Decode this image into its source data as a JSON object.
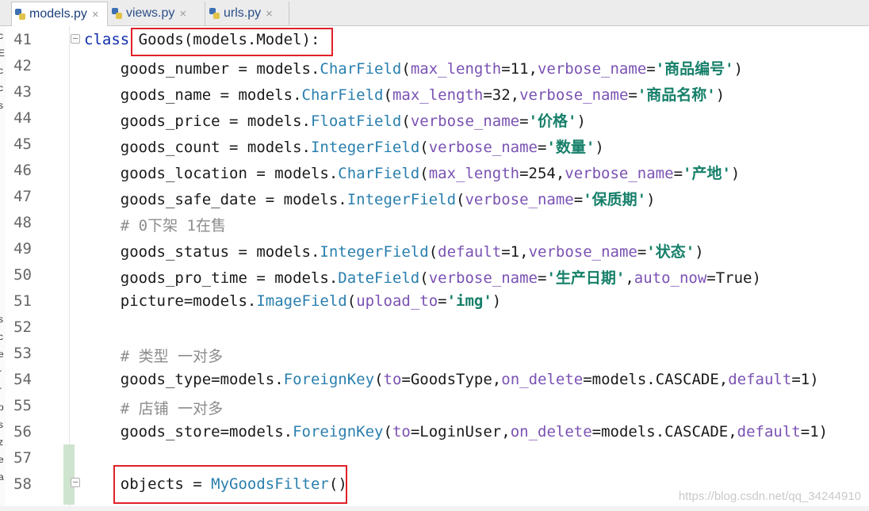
{
  "tabs": [
    {
      "label": "models.py",
      "active": true
    },
    {
      "label": "views.py",
      "active": false
    },
    {
      "label": "urls.py",
      "active": false
    }
  ],
  "close_glyph": "×",
  "left_panel_fragments": [
    "c",
    "E",
    "c",
    "c",
    "s",
    "s",
    "c",
    "e",
    "r",
    "r",
    "p",
    "s",
    "z",
    "e",
    "a"
  ],
  "lines": [
    {
      "num": "41",
      "tokens": [
        {
          "t": "class ",
          "c": "kw"
        },
        {
          "t": "Goods(models.Model):",
          "c": "plain"
        }
      ]
    },
    {
      "num": "42",
      "tokens": [
        {
          "t": "    goods_number = models.",
          "c": "plain"
        },
        {
          "t": "CharField",
          "c": "fn"
        },
        {
          "t": "(",
          "c": "plain"
        },
        {
          "t": "max_length",
          "c": "par"
        },
        {
          "t": "=11,",
          "c": "plain"
        },
        {
          "t": "verbose_name",
          "c": "par"
        },
        {
          "t": "=",
          "c": "plain"
        },
        {
          "t": "'商品编号'",
          "c": "str"
        },
        {
          "t": ")",
          "c": "plain"
        }
      ]
    },
    {
      "num": "43",
      "tokens": [
        {
          "t": "    goods_name = models.",
          "c": "plain"
        },
        {
          "t": "CharField",
          "c": "fn"
        },
        {
          "t": "(",
          "c": "plain"
        },
        {
          "t": "max_length",
          "c": "par"
        },
        {
          "t": "=32,",
          "c": "plain"
        },
        {
          "t": "verbose_name",
          "c": "par"
        },
        {
          "t": "=",
          "c": "plain"
        },
        {
          "t": "'商品名称'",
          "c": "str"
        },
        {
          "t": ")",
          "c": "plain"
        }
      ]
    },
    {
      "num": "44",
      "tokens": [
        {
          "t": "    goods_price = models.",
          "c": "plain"
        },
        {
          "t": "FloatField",
          "c": "fn"
        },
        {
          "t": "(",
          "c": "plain"
        },
        {
          "t": "verbose_name",
          "c": "par"
        },
        {
          "t": "=",
          "c": "plain"
        },
        {
          "t": "'价格'",
          "c": "str"
        },
        {
          "t": ")",
          "c": "plain"
        }
      ]
    },
    {
      "num": "45",
      "tokens": [
        {
          "t": "    goods_count = models.",
          "c": "plain"
        },
        {
          "t": "IntegerField",
          "c": "fn"
        },
        {
          "t": "(",
          "c": "plain"
        },
        {
          "t": "verbose_name",
          "c": "par"
        },
        {
          "t": "=",
          "c": "plain"
        },
        {
          "t": "'数量'",
          "c": "str"
        },
        {
          "t": ")",
          "c": "plain"
        }
      ]
    },
    {
      "num": "46",
      "tokens": [
        {
          "t": "    goods_location = models.",
          "c": "plain"
        },
        {
          "t": "CharField",
          "c": "fn"
        },
        {
          "t": "(",
          "c": "plain"
        },
        {
          "t": "max_length",
          "c": "par"
        },
        {
          "t": "=254,",
          "c": "plain"
        },
        {
          "t": "verbose_name",
          "c": "par"
        },
        {
          "t": "=",
          "c": "plain"
        },
        {
          "t": "'产地'",
          "c": "str"
        },
        {
          "t": ")",
          "c": "plain"
        }
      ]
    },
    {
      "num": "47",
      "tokens": [
        {
          "t": "    goods_safe_date = models.",
          "c": "plain"
        },
        {
          "t": "IntegerField",
          "c": "fn"
        },
        {
          "t": "(",
          "c": "plain"
        },
        {
          "t": "verbose_name",
          "c": "par"
        },
        {
          "t": "=",
          "c": "plain"
        },
        {
          "t": "'保质期'",
          "c": "str"
        },
        {
          "t": ")",
          "c": "plain"
        }
      ]
    },
    {
      "num": "48",
      "tokens": [
        {
          "t": "    # 0下架 1在售",
          "c": "cmt"
        }
      ]
    },
    {
      "num": "49",
      "tokens": [
        {
          "t": "    goods_status = models.",
          "c": "plain"
        },
        {
          "t": "IntegerField",
          "c": "fn"
        },
        {
          "t": "(",
          "c": "plain"
        },
        {
          "t": "default",
          "c": "par"
        },
        {
          "t": "=1,",
          "c": "plain"
        },
        {
          "t": "verbose_name",
          "c": "par"
        },
        {
          "t": "=",
          "c": "plain"
        },
        {
          "t": "'状态'",
          "c": "str"
        },
        {
          "t": ")",
          "c": "plain"
        }
      ]
    },
    {
      "num": "50",
      "tokens": [
        {
          "t": "    goods_pro_time = models.",
          "c": "plain"
        },
        {
          "t": "DateField",
          "c": "fn"
        },
        {
          "t": "(",
          "c": "plain"
        },
        {
          "t": "verbose_name",
          "c": "par"
        },
        {
          "t": "=",
          "c": "plain"
        },
        {
          "t": "'生产日期'",
          "c": "str"
        },
        {
          "t": ",",
          "c": "plain"
        },
        {
          "t": "auto_now",
          "c": "par"
        },
        {
          "t": "=True)",
          "c": "plain"
        }
      ]
    },
    {
      "num": "51",
      "tokens": [
        {
          "t": "    picture=models.",
          "c": "plain"
        },
        {
          "t": "ImageField",
          "c": "fn"
        },
        {
          "t": "(",
          "c": "plain"
        },
        {
          "t": "upload_to",
          "c": "par"
        },
        {
          "t": "=",
          "c": "plain"
        },
        {
          "t": "'img'",
          "c": "str"
        },
        {
          "t": ")",
          "c": "plain"
        }
      ]
    },
    {
      "num": "52",
      "tokens": []
    },
    {
      "num": "53",
      "tokens": [
        {
          "t": "    # 类型 一对多",
          "c": "cmt"
        }
      ]
    },
    {
      "num": "54",
      "tokens": [
        {
          "t": "    goods_type=models.",
          "c": "plain"
        },
        {
          "t": "ForeignKey",
          "c": "fn"
        },
        {
          "t": "(",
          "c": "plain"
        },
        {
          "t": "to",
          "c": "par"
        },
        {
          "t": "=GoodsType,",
          "c": "plain"
        },
        {
          "t": "on_delete",
          "c": "par"
        },
        {
          "t": "=models.CASCADE,",
          "c": "plain"
        },
        {
          "t": "default",
          "c": "par"
        },
        {
          "t": "=1)",
          "c": "plain"
        }
      ]
    },
    {
      "num": "55",
      "tokens": [
        {
          "t": "    # 店铺 一对多",
          "c": "cmt"
        }
      ]
    },
    {
      "num": "56",
      "tokens": [
        {
          "t": "    goods_store=models.",
          "c": "plain"
        },
        {
          "t": "ForeignKey",
          "c": "fn"
        },
        {
          "t": "(",
          "c": "plain"
        },
        {
          "t": "to",
          "c": "par"
        },
        {
          "t": "=LoginUser,",
          "c": "plain"
        },
        {
          "t": "on_delete",
          "c": "par"
        },
        {
          "t": "=models.CASCADE,",
          "c": "plain"
        },
        {
          "t": "default",
          "c": "par"
        },
        {
          "t": "=1)",
          "c": "plain"
        }
      ]
    },
    {
      "num": "57",
      "tokens": []
    },
    {
      "num": "58",
      "tokens": [
        {
          "t": "    objects = ",
          "c": "plain"
        },
        {
          "t": "MyGoodsFilter",
          "c": "fn"
        },
        {
          "t": "()",
          "c": "plain"
        }
      ]
    }
  ],
  "watermark": "https://blog.csdn.net/qq_34244910",
  "colors": {
    "highlight_box": "#e0202a",
    "string": "#17806a",
    "function": "#2a7fae",
    "param": "#7a52b3",
    "keyword": "#0f2fa8",
    "comment": "#8c8c8c"
  }
}
